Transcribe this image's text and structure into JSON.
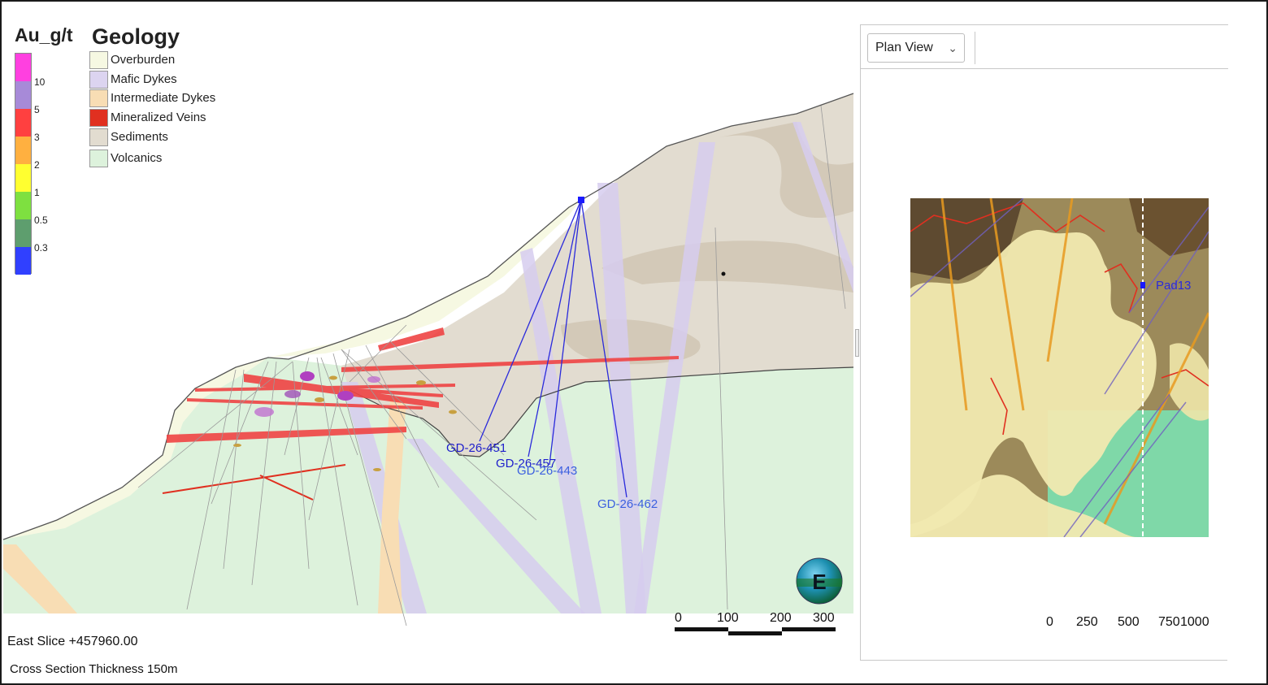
{
  "au_legend": {
    "title": "Au_g/t",
    "ticks": [
      "10",
      "5",
      "3",
      "2",
      "1",
      "0.5",
      "0.3"
    ],
    "colors": [
      "#ff40e0",
      "#a78ad8",
      "#ff4040",
      "#ffb040",
      "#ffff30",
      "#7ee040",
      "#5e9e6e",
      "#3040ff"
    ]
  },
  "geology_legend": {
    "title": "Geology",
    "items": [
      {
        "label": "Overburden",
        "color": "#f6f8e2"
      },
      {
        "label": "Mafic Dykes",
        "color": "#dcd4f0"
      },
      {
        "label": "Intermediate Dykes",
        "color": "#f8ddb4"
      },
      {
        "label": "Mineralized Veins",
        "color": "#e03020"
      },
      {
        "label": "Sediments",
        "color": "#e2dcd0"
      },
      {
        "label": "Volcanics",
        "color": "#ddf2dc"
      }
    ]
  },
  "section": {
    "drillholes": [
      {
        "label": "GD-26-451",
        "color": "#1e1ecc"
      },
      {
        "label": "GD-26-457",
        "color": "#1e1ecc"
      },
      {
        "label": "GD-26-443",
        "color": "#3b5fe0"
      },
      {
        "label": "GD-26-462",
        "color": "#3b5fe0"
      }
    ],
    "orientation_badge": "E",
    "scalebar_labels": [
      "0",
      "100",
      "200",
      "300"
    ],
    "slice_label": "East Slice +457960.00",
    "thickness_label": "Cross Section Thickness 150m"
  },
  "plan_view": {
    "view_select": "Plan View",
    "pad_label": "Pad13",
    "scalebar_labels": [
      "0",
      "250",
      "500",
      "750",
      "1000"
    ]
  }
}
